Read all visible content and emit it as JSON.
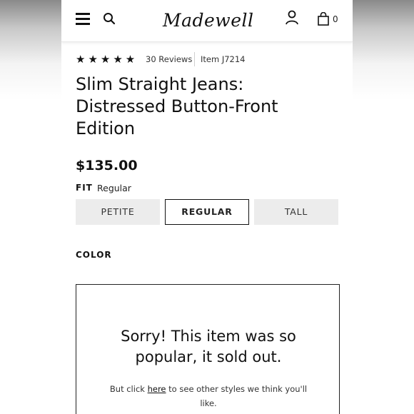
{
  "header": {
    "logo_text": "Madewell",
    "bag_count": "0"
  },
  "product": {
    "stars": "★★★★★",
    "rating_value": 5,
    "reviews_label": "30 Reviews",
    "item_code": "Item J7214",
    "title": "Slim Straight Jeans: Distressed Button-Front Edition",
    "price": "$135.00",
    "fit_label": "FIT",
    "fit_value": "Regular",
    "fit_options": [
      {
        "label": "PETITE",
        "selected": false
      },
      {
        "label": "REGULAR",
        "selected": true
      },
      {
        "label": "TALL",
        "selected": false
      }
    ],
    "color_label": "COLOR"
  },
  "soldout": {
    "message": "Sorry! This item was so popular, it sold out.",
    "sub_prefix": "But click ",
    "sub_link": "here",
    "sub_suffix": " to see other styles we think you'll like."
  },
  "colors": {
    "text": "#111111",
    "button_bg": "#ececec",
    "selected_border": "#111111"
  },
  "icons": [
    "menu-icon",
    "search-icon",
    "account-icon",
    "shopping-bag-icon",
    "star-icon"
  ]
}
